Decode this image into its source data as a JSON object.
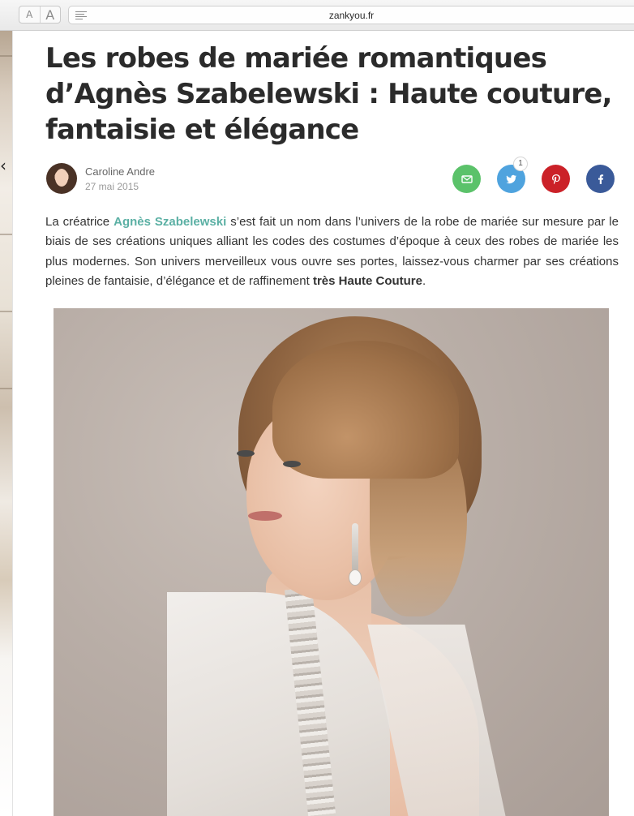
{
  "toolbar": {
    "font_small_label": "A",
    "font_large_label": "A",
    "url": "zankyou.fr"
  },
  "article": {
    "title": "Les robes de mariée romantiques d’Agnès Szabelewski : Haute couture, fantaisie et élégance",
    "author": "Caroline Andre",
    "date": "27 mai 2015",
    "share": {
      "twitter_count": "1"
    },
    "intro": {
      "part1": "La créatrice ",
      "link": "Agnès Szabelewski",
      "part2": " s’est fait un nom dans l’univers de la robe de mariée sur mesure par le biais de ses créations uniques alliant les codes des costumes d’époque à ceux des robes de mariée les plus modernes. Son univers merveilleux vous ouvre ses portes, laissez-vous charmer par ses créations pleines de fantaisie, d’élégance et de raffinement ",
      "bold": "très Haute Couture",
      "part3": "."
    }
  },
  "colors": {
    "email": "#5bc26a",
    "twitter": "#4fa3de",
    "pinterest": "#cb2128",
    "facebook": "#3a5a99",
    "link": "#5bb0a4"
  },
  "icons": [
    "email-icon",
    "twitter-icon",
    "pinterest-icon",
    "facebook-icon",
    "reader-list-icon"
  ]
}
